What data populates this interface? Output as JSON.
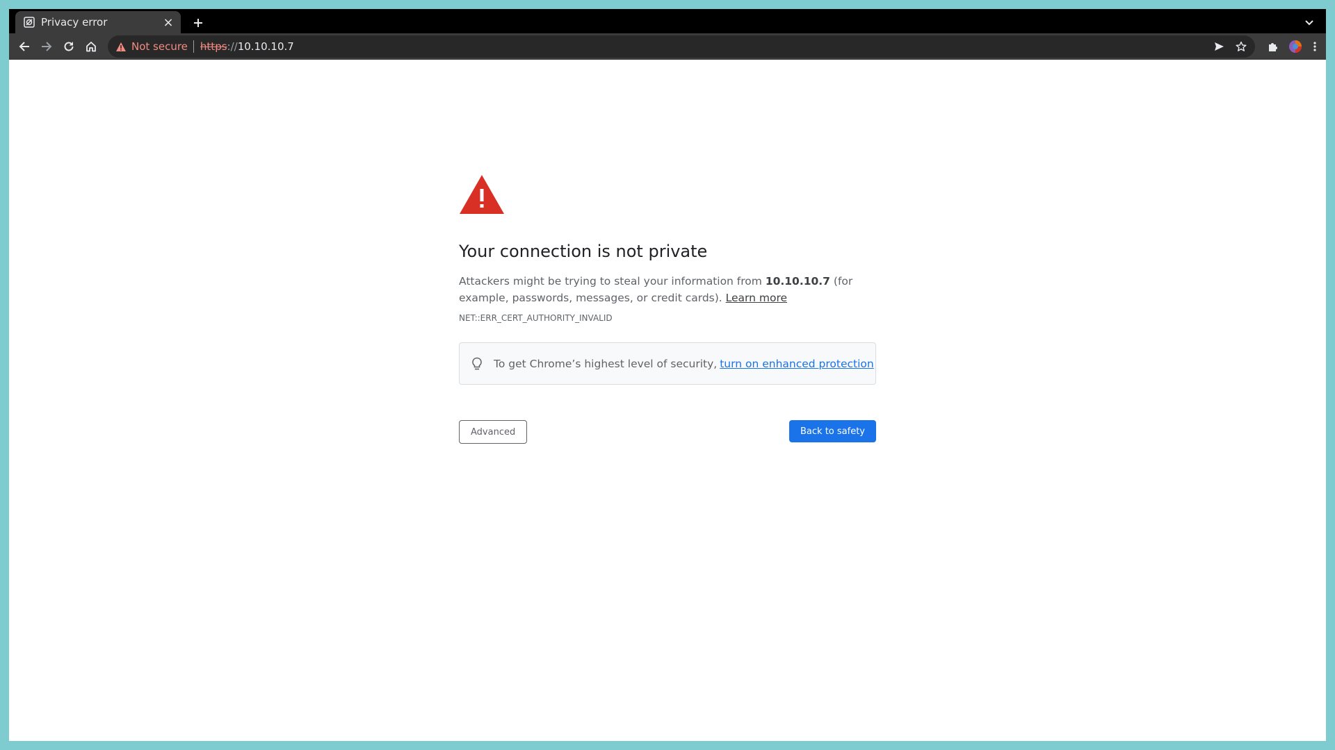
{
  "tab": {
    "title": "Privacy error",
    "close_label": "×"
  },
  "omnibox": {
    "security_label": "Not secure",
    "scheme": "https",
    "slashes": "://",
    "host": "10.10.10.7"
  },
  "page": {
    "heading": "Your connection is not private",
    "explanation_prefix": "Attackers might be trying to steal your information from ",
    "explanation_host": "10.10.10.7",
    "explanation_suffix": " (for example, passwords, messages, or credit cards). ",
    "learn_more": "Learn more",
    "error_code": "NET::ERR_CERT_AUTHORITY_INVALID",
    "enhanced_prefix": "To get Chrome’s highest level of security,",
    "enhanced_link": "turn on enhanced protection",
    "advanced_button": "Advanced",
    "back_button": "Back to safety"
  },
  "colors": {
    "warning_red": "#d93025",
    "primary_blue": "#1a73e8",
    "not_secure_red": "#f28b82"
  },
  "icons": {
    "back": "arrow-left-icon",
    "forward": "arrow-right-icon",
    "reload": "reload-icon",
    "home": "home-icon",
    "send": "send-icon",
    "bookmark": "star-icon",
    "extensions": "puzzle-icon",
    "profile": "avatar",
    "menu": "kebab-menu-icon"
  }
}
